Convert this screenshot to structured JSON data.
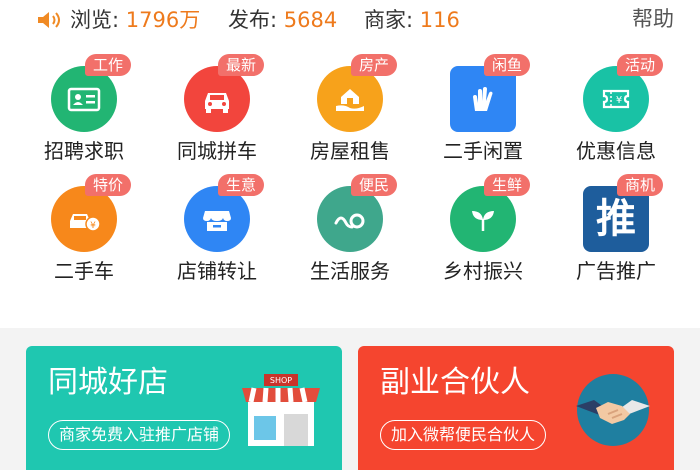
{
  "stats": {
    "views_label": "浏览:",
    "views_value": "1796万",
    "posts_label": "发布:",
    "posts_value": "5684",
    "merchants_label": "商家:",
    "merchants_value": "116",
    "help": "帮助"
  },
  "categories": [
    {
      "label": "招聘求职",
      "badge": "工作",
      "icon": "id-card-icon",
      "color": "#22b573"
    },
    {
      "label": "同城拼车",
      "badge": "最新",
      "icon": "car-icon",
      "color": "#f2453d"
    },
    {
      "label": "房屋租售",
      "badge": "房产",
      "icon": "house-hand-icon",
      "color": "#f7a21b"
    },
    {
      "label": "二手闲置",
      "badge": "闲鱼",
      "icon": "hand-icon",
      "color": "#2f86f4"
    },
    {
      "label": "优惠信息",
      "badge": "活动",
      "icon": "coupon-icon",
      "color": "#19c2a5"
    },
    {
      "label": "二手车",
      "badge": "特价",
      "icon": "car-price-icon",
      "color": "#f7881b"
    },
    {
      "label": "店铺转让",
      "badge": "生意",
      "icon": "shop-icon",
      "color": "#2f86f4"
    },
    {
      "label": "生活服务",
      "badge": "便民",
      "icon": "wave-icon",
      "color": "#3fa78c"
    },
    {
      "label": "乡村振兴",
      "badge": "生鲜",
      "icon": "sprout-icon",
      "color": "#22b573"
    },
    {
      "label": "广告推广",
      "badge": "商机",
      "icon": "tui-icon",
      "color": "#1e5d9c"
    }
  ],
  "promos": {
    "left": {
      "title": "同城好店",
      "button": "商家免费入驻推广店铺",
      "color": "#1fc7b0",
      "art_text": "SHOP"
    },
    "right": {
      "title": "副业合伙人",
      "button": "加入微帮便民合伙人",
      "color": "#f5452f"
    }
  },
  "tui_char": "推"
}
